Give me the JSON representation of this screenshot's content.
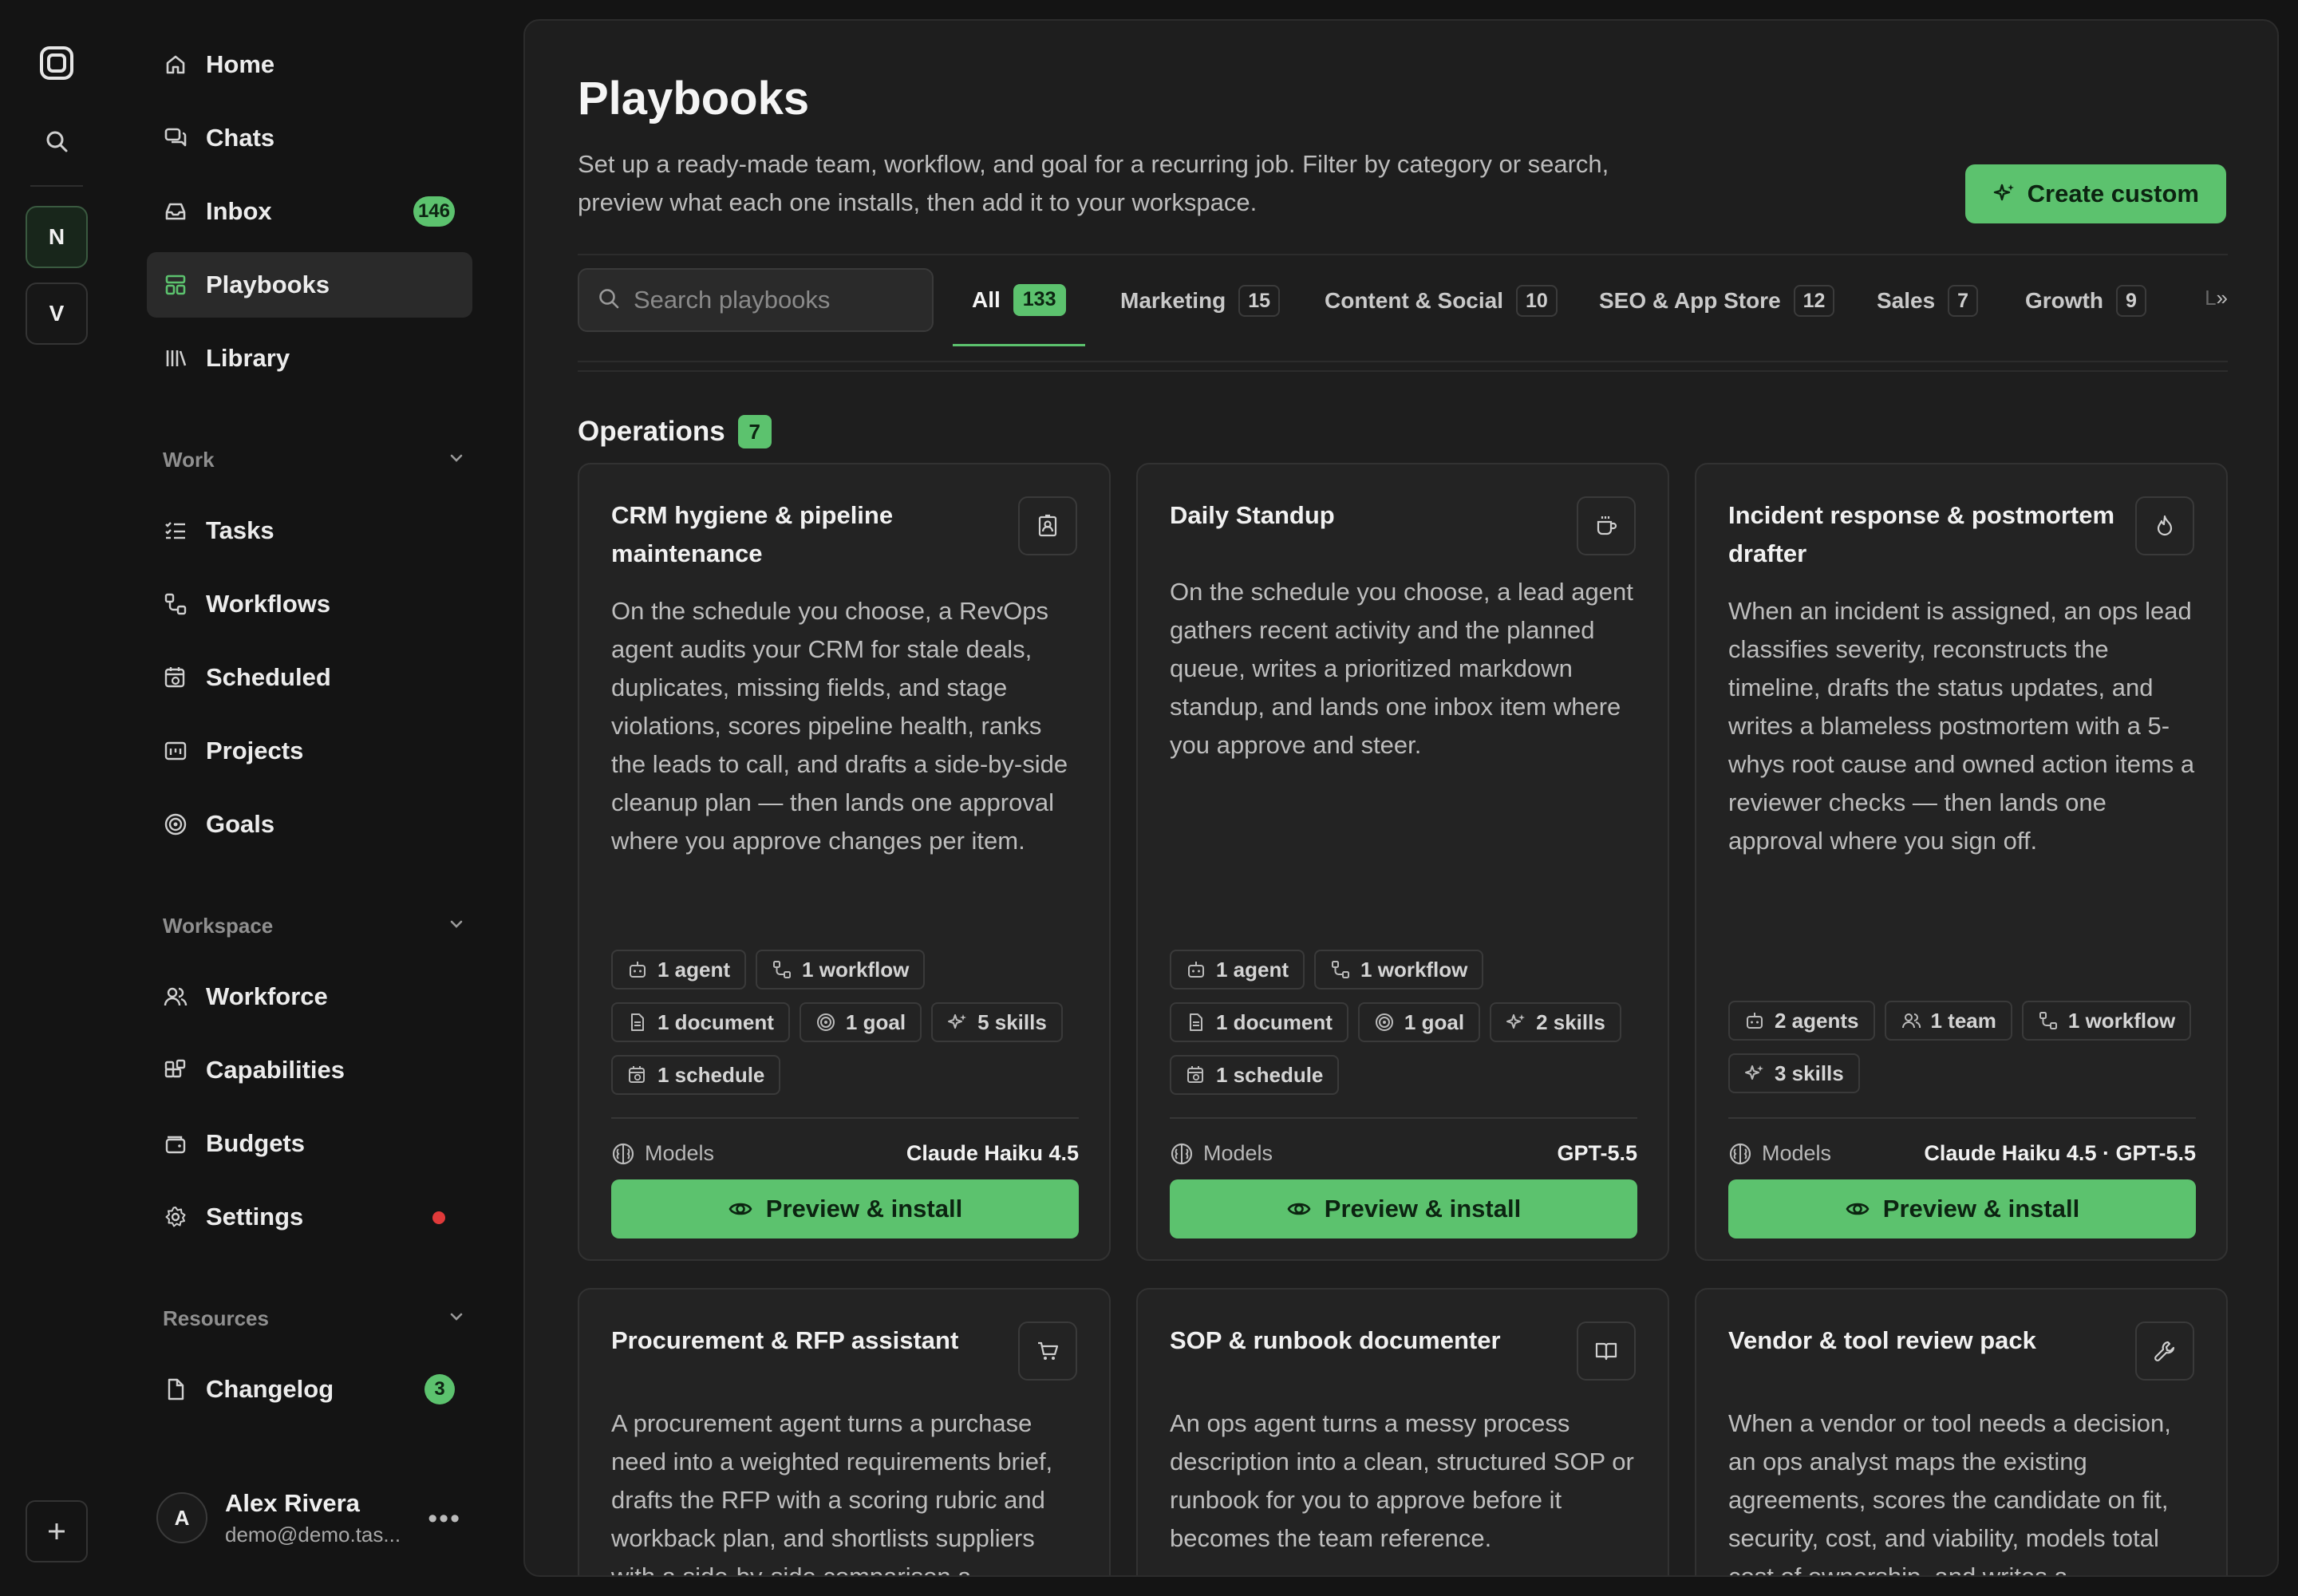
{
  "sidebar": {
    "items": [
      {
        "label": "Home"
      },
      {
        "label": "Chats"
      },
      {
        "label": "Inbox",
        "badge": "146"
      },
      {
        "label": "Playbooks"
      },
      {
        "label": "Library"
      }
    ],
    "work": {
      "title": "Work",
      "items": [
        {
          "label": "Tasks"
        },
        {
          "label": "Workflows"
        },
        {
          "label": "Scheduled"
        },
        {
          "label": "Projects"
        },
        {
          "label": "Goals"
        }
      ]
    },
    "workspace": {
      "title": "Workspace",
      "items": [
        {
          "label": "Workforce"
        },
        {
          "label": "Capabilities"
        },
        {
          "label": "Budgets"
        },
        {
          "label": "Settings"
        }
      ]
    },
    "resources": {
      "title": "Resources",
      "items": [
        {
          "label": "Changelog",
          "badge": "3"
        }
      ]
    },
    "user": {
      "initial": "A",
      "name": "Alex Rivera",
      "email": "demo@demo.tas..."
    }
  },
  "rail": {
    "workspaces": [
      {
        "initial": "N"
      },
      {
        "initial": "V"
      }
    ]
  },
  "page": {
    "title": "Playbooks",
    "description": "Set up a ready-made team, workflow, and goal for a recurring job. Filter by category or search, preview what each one installs, then add it to your workspace.",
    "create_label": "Create custom",
    "search_placeholder": "Search playbooks"
  },
  "tabs": [
    {
      "label": "All",
      "count": "133"
    },
    {
      "label": "Marketing",
      "count": "15"
    },
    {
      "label": "Content & Social",
      "count": "10"
    },
    {
      "label": "SEO & App Store",
      "count": "12"
    },
    {
      "label": "Sales",
      "count": "7"
    },
    {
      "label": "Growth",
      "count": "9"
    }
  ],
  "tab_more": "L",
  "section": {
    "title": "Operations",
    "count": "7"
  },
  "models_label": "Models",
  "install_label": "Preview & install",
  "cards": [
    {
      "title": "CRM hygiene & pipeline maintenance",
      "icon": "contact-card-icon",
      "description": "On the schedule you choose, a RevOps agent audits your CRM for stale deals, duplicates, missing fields, and stage violations, scores pipeline health, ranks the leads to call, and drafts a side-by-side cleanup plan — then lands one approval where you approve changes per item.",
      "chips": [
        "1 agent",
        "1 workflow",
        "1 document",
        "1 goal",
        "5 skills",
        "1 schedule"
      ],
      "models": "Claude Haiku 4.5"
    },
    {
      "title": "Daily Standup",
      "icon": "coffee-icon",
      "description": "On the schedule you choose, a lead agent gathers recent activity and the planned queue, writes a prioritized markdown standup, and lands one inbox item where you approve and steer.",
      "chips": [
        "1 agent",
        "1 workflow",
        "1 document",
        "1 goal",
        "2 skills",
        "1 schedule"
      ],
      "models": "GPT-5.5"
    },
    {
      "title": "Incident response & postmortem drafter",
      "icon": "flame-icon",
      "description": "When an incident is assigned, an ops lead classifies severity, reconstructs the timeline, drafts the status updates, and writes a blameless postmortem with a 5-whys root cause and owned action items a reviewer checks — then lands one approval where you sign off.",
      "chips": [
        "2 agents",
        "1 team",
        "1 workflow",
        "3 skills"
      ],
      "models": "Claude Haiku 4.5 · GPT-5.5"
    },
    {
      "title": "Procurement & RFP assistant",
      "icon": "cart-icon",
      "description": "A procurement agent turns a purchase need into a weighted requirements brief, drafts the RFP with a scoring rubric and workback plan, and shortlists suppliers with a side-by-side comparison a"
    },
    {
      "title": "SOP & runbook documenter",
      "icon": "book-open-icon",
      "description": "An ops agent turns a messy process description into a clean, structured SOP or runbook for you to approve before it becomes the team reference."
    },
    {
      "title": "Vendor & tool review pack",
      "icon": "wrench-icon",
      "description": "When a vendor or tool needs a decision, an ops analyst maps the existing agreements, scores the candidate on fit, security, cost, and viability, models total cost of ownership, and writes a"
    }
  ],
  "colors": {
    "accent": "#5cc26e",
    "background": "#141414",
    "panel": "#1e1e1e",
    "card": "#232323",
    "alert": "#e03a3a"
  }
}
